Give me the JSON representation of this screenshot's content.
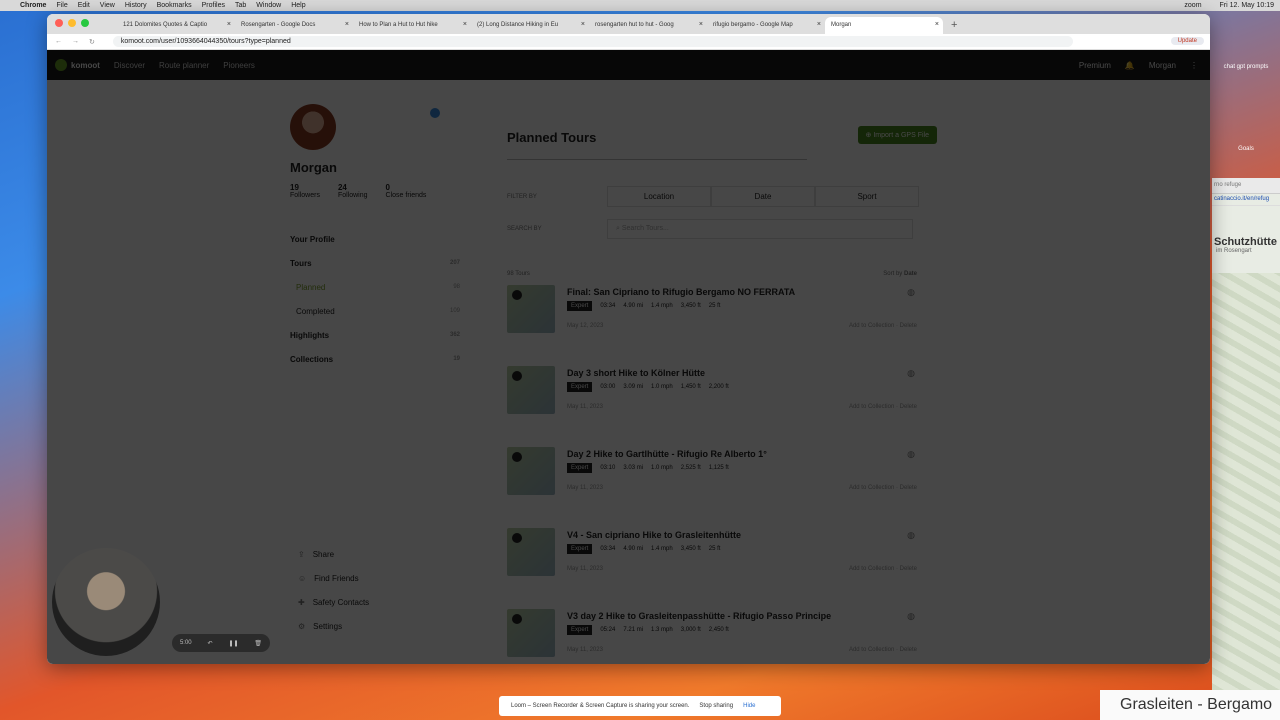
{
  "menubar": {
    "apple": "",
    "app": "Chrome",
    "items": [
      "File",
      "Edit",
      "View",
      "History",
      "Bookmarks",
      "Profiles",
      "Tab",
      "Window",
      "Help"
    ],
    "right_zoom": "zoom",
    "clock": "Fri 12. May 10:19"
  },
  "desktop": {
    "items": [
      "chat gpt prompts",
      "Goals"
    ]
  },
  "map_window": {
    "tab": "rno refuge",
    "url": "catinaccio.it/en/refug",
    "title": "Schutzhütte",
    "subtitle": "im Rosengart"
  },
  "gras_caption": "Grasleiten - Bergamo",
  "browser": {
    "tabs": [
      {
        "label": "121 Dolomites Quotes & Captio"
      },
      {
        "label": "Rosengarten - Google Docs"
      },
      {
        "label": "How to Plan a Hut to Hut hike"
      },
      {
        "label": "(2) Long Distance Hiking in Eu"
      },
      {
        "label": "rosengarten hut to hut - Goog"
      },
      {
        "label": "rifugio bergamo - Google Map"
      },
      {
        "label": "Morgan"
      }
    ],
    "url": "komoot.com/user/1093664044350/tours?type=planned",
    "update": "Update"
  },
  "nav": {
    "logo": "komoot",
    "links": [
      "Discover",
      "Route planner",
      "Pioneers"
    ],
    "premium": "Premium",
    "user": "Morgan"
  },
  "profile": {
    "name": "Morgan",
    "stats": [
      {
        "n": "19",
        "l": "Followers"
      },
      {
        "n": "24",
        "l": "Following"
      },
      {
        "n": "0",
        "l": "Close friends"
      }
    ],
    "menu": [
      {
        "label": "Your Profile",
        "count": ""
      },
      {
        "label": "Tours",
        "count": "207"
      },
      {
        "label": "Planned",
        "count": "98"
      },
      {
        "label": "Completed",
        "count": "109"
      },
      {
        "label": "Highlights",
        "count": "362"
      },
      {
        "label": "Collections",
        "count": "19"
      }
    ],
    "bottom": [
      {
        "icon": "share-icon",
        "glyph": "⇪",
        "label": "Share"
      },
      {
        "icon": "people-icon",
        "glyph": "☺",
        "label": "Find Friends"
      },
      {
        "icon": "shield-icon",
        "glyph": "✚",
        "label": "Safety Contacts"
      },
      {
        "icon": "gear-icon",
        "glyph": "⚙",
        "label": "Settings"
      }
    ]
  },
  "main": {
    "title": "Planned Tours",
    "import": "Import a GPS File",
    "filter_by": "FILTER BY",
    "filters": [
      "Location",
      "Date",
      "Sport"
    ],
    "search_by": "SEARCH BY",
    "search_placeholder": "Search Tours...",
    "count": "98 Tours",
    "sort_label": "Sort by",
    "sort_value": "Date",
    "tours": [
      {
        "title": "Final: San Cipriano to Rifugio Bergamo NO FERRATA",
        "level": "Expert",
        "time": "03:34",
        "dist": "4.90 mi",
        "speed": "1.4 mph",
        "up": "3,450 ft",
        "down": "25 ft",
        "date": "May 12, 2023"
      },
      {
        "title": "Day 3 short Hike to Kölner Hütte",
        "level": "Expert",
        "time": "03:00",
        "dist": "3.09 mi",
        "speed": "1.0 mph",
        "up": "1,450 ft",
        "down": "2,200 ft",
        "date": "May 11, 2023"
      },
      {
        "title": "Day 2 Hike to Gartlhütte - Rifugio Re Alberto 1°",
        "level": "Expert",
        "time": "03:10",
        "dist": "3.03 mi",
        "speed": "1.0 mph",
        "up": "2,525 ft",
        "down": "1,125 ft",
        "date": "May 11, 2023"
      },
      {
        "title": "V4 - San cipriano Hike to Grasleitenhütte",
        "level": "Expert",
        "time": "03:34",
        "dist": "4.90 mi",
        "speed": "1.4 mph",
        "up": "3,450 ft",
        "down": "25 ft",
        "date": "May 11, 2023"
      },
      {
        "title": "V3 day 2 Hike to Grasleitenpasshütte - Rifugio Passo Principe",
        "level": "Expert",
        "time": "05:24",
        "dist": "7.21 mi",
        "speed": "1.3 mph",
        "up": "3,000 ft",
        "down": "2,450 ft",
        "date": "May 11, 2023"
      }
    ],
    "add_collection": "Add to Collection",
    "delete": "Delete"
  },
  "recorder": {
    "time": "5:00"
  },
  "loom": {
    "msg": "Loom – Screen Recorder & Screen Capture is sharing your screen.",
    "stop": "Stop sharing",
    "hide": "Hide"
  }
}
